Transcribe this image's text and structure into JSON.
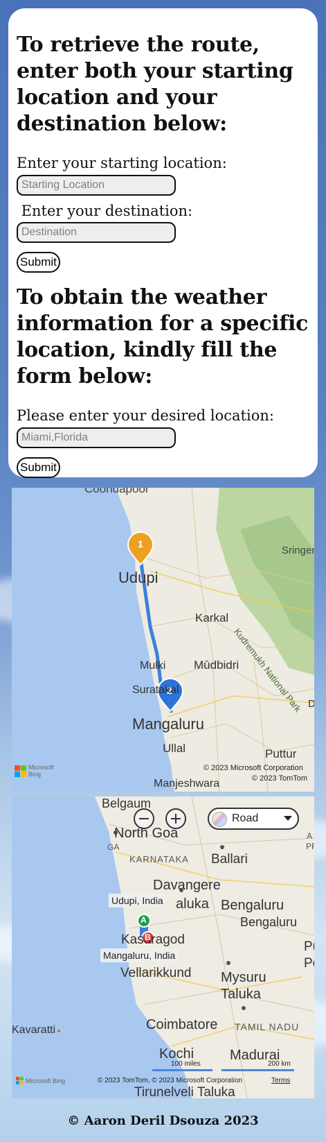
{
  "route_form": {
    "heading": "To retrieve the route, enter both your starting location and your destination below:",
    "start_label": "Enter your starting location:",
    "start_placeholder": "Starting Location",
    "start_value": "",
    "dest_label": " Enter your destination:",
    "dest_placeholder": "Destination",
    "dest_value": "",
    "submit_label": "Submit"
  },
  "weather_form": {
    "heading": "To obtain the weather information for a specific location, kindly fill the form below:",
    "location_label": "Please enter your desired location:",
    "location_placeholder": "Miami,Florida",
    "location_value": "",
    "submit_label": "Submit"
  },
  "route_map": {
    "places": {
      "coondapoor": "Coondapoor",
      "udupi": "Udupi",
      "sringeri": "Sringer",
      "kudremukh": "Kudremukh National Park",
      "karkal": "Karkal",
      "mulki": "Mulki",
      "moodbidri": "Mūdbidri",
      "suratakal": "Suratakal",
      "mangaluru": "Mangaluru",
      "ullal": "Ullal",
      "puttur": "Puttur",
      "manjeshwara": "Manjeshwara",
      "d_edge": "D"
    },
    "pin1": "1",
    "pin2": "2",
    "copyright1": "© 2023 Microsoft Corporation",
    "copyright2": "© 2023 TomTom",
    "logo": "Microsoft Bing",
    "colors": {
      "route": "#3d7fe0",
      "pin1": "#f0a020",
      "pin2": "#2f73d8"
    }
  },
  "overview_map": {
    "places": {
      "belgaum": "Belgaum",
      "north_goa": "North Goa",
      "ga": "GA",
      "karnataka": "KARNATAKA",
      "ballari": "Ballari",
      "davangere": "Davangere",
      "aluka": "aluka",
      "bengaluru_taluka": "Bengaluru",
      "bengaluru": "Bengaluru",
      "kasaragod": "Kasaragod",
      "vellarikkund": "Vellarikkund",
      "mysuru": "Mysuru",
      "taluka": "Taluka",
      "coimbatore": "Coimbatore",
      "tamil_nadu": "TAMIL NADU",
      "kavaratti": "Kavaratti",
      "kochi": "Kochi",
      "madurai": "Madurai",
      "tirunelveli": "Tirunelveli Taluka",
      "right_a": "A",
      "right_pr": "PR",
      "right_pu": "Pu",
      "right_po": "Po"
    },
    "label_a": "Udupi, India",
    "label_b": "Mangaluru, India",
    "pin_a": "A",
    "pin_b": "B",
    "map_type": "Road",
    "scale_miles": "100 miles",
    "scale_km": "200 km",
    "copyright": "© 2023 TomTom, © 2023 Microsoft Corporation",
    "terms": "Terms",
    "logo": "Microsoft Bing",
    "colors": {
      "pin_a": "#1aa34a",
      "pin_b": "#e03a3a"
    }
  },
  "footer": {
    "text": "© Aaron Deril Dsouza 2023"
  }
}
